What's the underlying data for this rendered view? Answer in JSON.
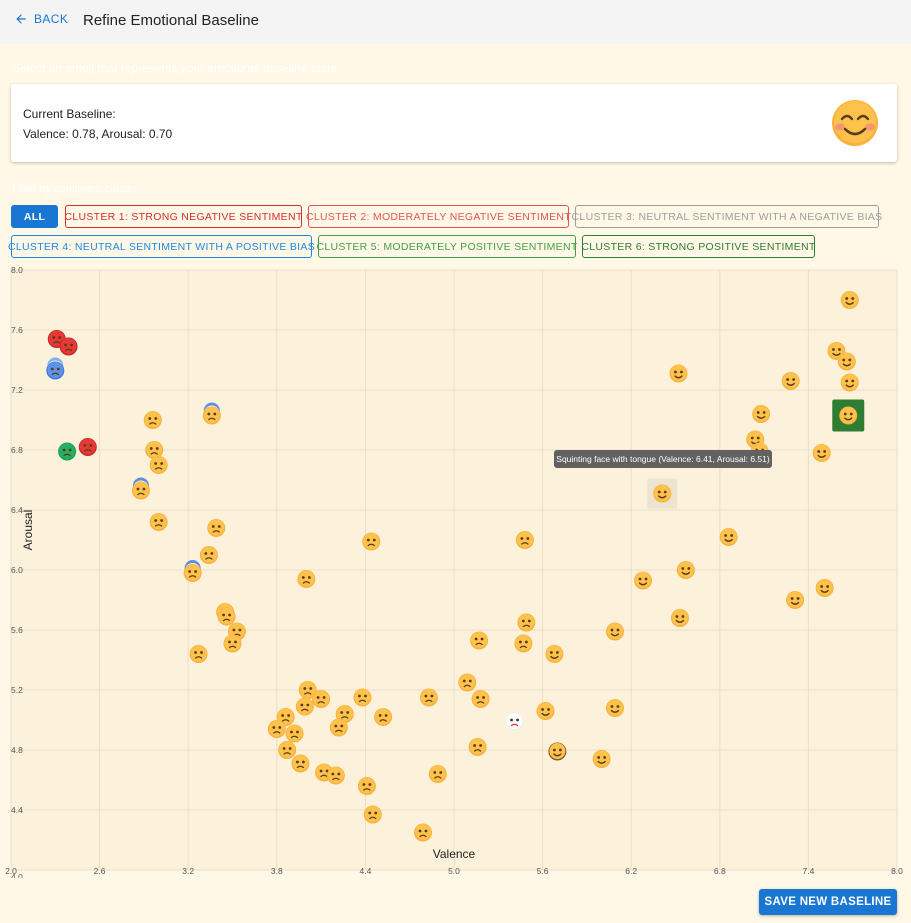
{
  "header": {
    "back_label": "BACK",
    "title": "Refine Emotional Baseline"
  },
  "instruction": "Select an emoji that represents your emotional baseline state",
  "baseline": {
    "heading": "Current Baseline:",
    "values_text": "Valence: 0.78, Arousal: 0.70",
    "emoji": "smiling-face-with-smiling-eyes-icon"
  },
  "filter_label": "Filter by sentiment cluster",
  "filters": [
    {
      "label": "ALL",
      "color": "#1976d2",
      "active": true
    },
    {
      "label": "CLUSTER 1: STRONG NEGATIVE SENTIMENT",
      "color": "#d32f2f"
    },
    {
      "label": "CLUSTER 2: MODERATELY NEGATIVE SENTIMENT",
      "color": "#e25555"
    },
    {
      "label": "CLUSTER 3: NEUTRAL SENTIMENT WITH A NEGATIVE BIAS",
      "color": "#9e9e9e"
    },
    {
      "label": "CLUSTER 4: NEUTRAL SENTIMENT WITH A POSITIVE BIAS",
      "color": "#1e88e5"
    },
    {
      "label": "CLUSTER 5: MODERATELY POSITIVE SENTIMENT",
      "color": "#43a047"
    },
    {
      "label": "CLUSTER 6: STRONG POSITIVE SENTIMENT",
      "color": "#2e7d32"
    }
  ],
  "tooltip": "Squinting face with tongue (Valence: 6.41, Arousal: 6.51)",
  "save_label": "SAVE NEW BASELINE",
  "chart_data": {
    "type": "scatter",
    "xlabel": "Valence",
    "ylabel": "Arousal",
    "xlim": [
      2.0,
      8.0
    ],
    "ylim": [
      4.0,
      8.0
    ],
    "x_ticks": [
      "2.0",
      "2.6",
      "3.2",
      "3.8",
      "4.4",
      "5.0",
      "5.6",
      "6.2",
      "6.8",
      "7.4",
      "8.0"
    ],
    "y_ticks": [
      "4.0",
      "4.4",
      "4.8",
      "5.2",
      "5.6",
      "6.0",
      "6.4",
      "6.8",
      "7.2",
      "7.6",
      "8.0"
    ],
    "grid": true,
    "points": [
      {
        "x": 2.31,
        "y": 7.54,
        "kind": "angry-red"
      },
      {
        "x": 2.39,
        "y": 7.49,
        "kind": "angry-red"
      },
      {
        "x": 2.3,
        "y": 7.33,
        "kind": "cold-blue"
      },
      {
        "x": 2.38,
        "y": 6.79,
        "kind": "sick-green"
      },
      {
        "x": 2.52,
        "y": 6.82,
        "kind": "angry-red"
      },
      {
        "x": 2.96,
        "y": 7.0,
        "kind": "crying"
      },
      {
        "x": 3.36,
        "y": 7.03,
        "kind": "fearful"
      },
      {
        "x": 2.97,
        "y": 6.8,
        "kind": "yellow"
      },
      {
        "x": 3.0,
        "y": 6.7,
        "kind": "yellow"
      },
      {
        "x": 2.88,
        "y": 6.53,
        "kind": "fearful"
      },
      {
        "x": 3.0,
        "y": 6.32,
        "kind": "yellow"
      },
      {
        "x": 3.39,
        "y": 6.28,
        "kind": "yellow"
      },
      {
        "x": 3.34,
        "y": 6.1,
        "kind": "yellow"
      },
      {
        "x": 3.23,
        "y": 5.98,
        "kind": "fearful"
      },
      {
        "x": 4.0,
        "y": 5.94,
        "kind": "yellow"
      },
      {
        "x": 4.44,
        "y": 6.19,
        "kind": "yellow"
      },
      {
        "x": 3.45,
        "y": 5.72,
        "kind": "yellow"
      },
      {
        "x": 3.46,
        "y": 5.69,
        "kind": "yellow"
      },
      {
        "x": 3.53,
        "y": 5.59,
        "kind": "yellow"
      },
      {
        "x": 3.5,
        "y": 5.51,
        "kind": "yellow"
      },
      {
        "x": 3.27,
        "y": 5.44,
        "kind": "yellow"
      },
      {
        "x": 4.01,
        "y": 5.2,
        "kind": "yellow"
      },
      {
        "x": 4.1,
        "y": 5.14,
        "kind": "yellow"
      },
      {
        "x": 3.99,
        "y": 5.09,
        "kind": "yellow"
      },
      {
        "x": 4.38,
        "y": 5.15,
        "kind": "yellow"
      },
      {
        "x": 4.26,
        "y": 5.04,
        "kind": "yellow"
      },
      {
        "x": 4.52,
        "y": 5.02,
        "kind": "yellow"
      },
      {
        "x": 3.86,
        "y": 5.02,
        "kind": "yellow"
      },
      {
        "x": 3.8,
        "y": 4.94,
        "kind": "yellow"
      },
      {
        "x": 3.92,
        "y": 4.91,
        "kind": "yellow"
      },
      {
        "x": 4.22,
        "y": 4.95,
        "kind": "yellow"
      },
      {
        "x": 3.87,
        "y": 4.8,
        "kind": "yellow"
      },
      {
        "x": 3.96,
        "y": 4.71,
        "kind": "yellow"
      },
      {
        "x": 4.12,
        "y": 4.65,
        "kind": "yellow"
      },
      {
        "x": 4.2,
        "y": 4.63,
        "kind": "yellow"
      },
      {
        "x": 4.41,
        "y": 4.56,
        "kind": "yellow"
      },
      {
        "x": 4.45,
        "y": 4.37,
        "kind": "yellow"
      },
      {
        "x": 4.79,
        "y": 4.25,
        "kind": "yellow"
      },
      {
        "x": 4.89,
        "y": 4.64,
        "kind": "yellow"
      },
      {
        "x": 4.83,
        "y": 5.15,
        "kind": "yellow"
      },
      {
        "x": 5.09,
        "y": 5.25,
        "kind": "yellow"
      },
      {
        "x": 5.18,
        "y": 5.14,
        "kind": "yellow"
      },
      {
        "x": 5.17,
        "y": 5.53,
        "kind": "yellow"
      },
      {
        "x": 5.16,
        "y": 4.82,
        "kind": "yellow"
      },
      {
        "x": 5.41,
        "y": 4.99,
        "kind": "clown"
      },
      {
        "x": 5.48,
        "y": 6.2,
        "kind": "yellow"
      },
      {
        "x": 5.49,
        "y": 5.65,
        "kind": "yellow"
      },
      {
        "x": 5.47,
        "y": 5.51,
        "kind": "yellow"
      },
      {
        "x": 5.68,
        "y": 5.44,
        "kind": "yellow"
      },
      {
        "x": 5.62,
        "y": 5.06,
        "kind": "yellow"
      },
      {
        "x": 5.7,
        "y": 4.79,
        "kind": "monkey"
      },
      {
        "x": 6.0,
        "y": 4.74,
        "kind": "yellow"
      },
      {
        "x": 6.09,
        "y": 5.08,
        "kind": "yellow"
      },
      {
        "x": 6.09,
        "y": 5.59,
        "kind": "yellow"
      },
      {
        "x": 6.28,
        "y": 5.93,
        "kind": "yellow"
      },
      {
        "x": 6.57,
        "y": 6.0,
        "kind": "yellow"
      },
      {
        "x": 6.53,
        "y": 5.68,
        "kind": "yellow"
      },
      {
        "x": 6.41,
        "y": 6.51,
        "kind": "yellow",
        "selected": true
      },
      {
        "x": 6.52,
        "y": 7.31,
        "kind": "yellow"
      },
      {
        "x": 6.86,
        "y": 6.22,
        "kind": "yellow"
      },
      {
        "x": 7.04,
        "y": 6.87,
        "kind": "yellow"
      },
      {
        "x": 7.08,
        "y": 7.04,
        "kind": "yellow"
      },
      {
        "x": 7.07,
        "y": 6.79,
        "kind": "yellow"
      },
      {
        "x": 7.28,
        "y": 7.26,
        "kind": "yellow"
      },
      {
        "x": 7.49,
        "y": 6.78,
        "kind": "yellow"
      },
      {
        "x": 7.31,
        "y": 5.8,
        "kind": "yellow"
      },
      {
        "x": 7.51,
        "y": 5.88,
        "kind": "yellow"
      },
      {
        "x": 7.59,
        "y": 7.46,
        "kind": "yellow"
      },
      {
        "x": 7.66,
        "y": 7.39,
        "kind": "yellow"
      },
      {
        "x": 7.68,
        "y": 7.25,
        "kind": "yellow"
      },
      {
        "x": 7.68,
        "y": 7.8,
        "kind": "yellow"
      },
      {
        "x": 7.67,
        "y": 7.03,
        "kind": "yellow",
        "current": true
      }
    ]
  }
}
